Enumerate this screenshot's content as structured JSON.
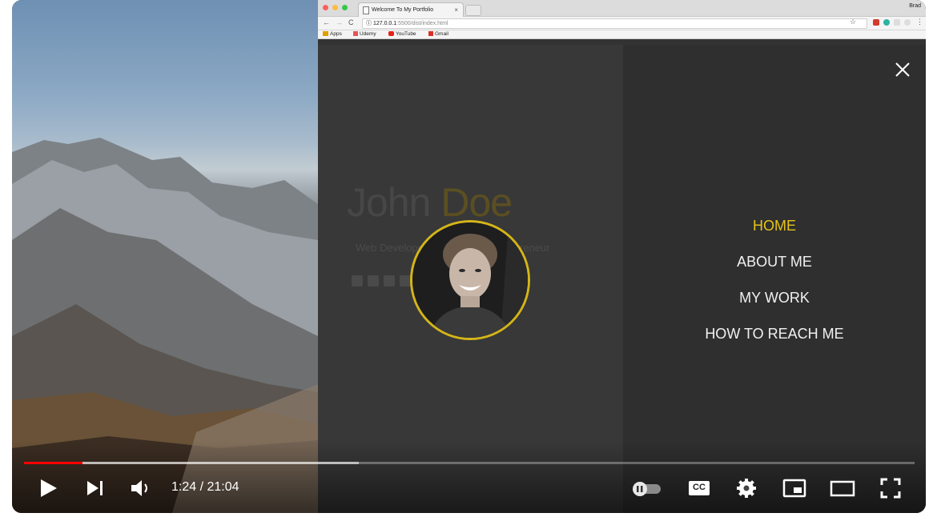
{
  "browser": {
    "tab_title": "Welcome To My Portfolio",
    "tab_close": "×",
    "user": "Brad",
    "url_host": "127.0.0.1",
    "url_path": ":5500/dist/index.html",
    "bookmarks": [
      {
        "label": "Apps",
        "icon": "apps-grid-icon",
        "color": "#e0a000"
      },
      {
        "label": "Udemy",
        "icon": "udemy-icon",
        "color": "#ec5252"
      },
      {
        "label": "YouTube",
        "icon": "youtube-icon",
        "color": "#e62117"
      },
      {
        "label": "Gmail",
        "icon": "gmail-icon",
        "color": "#d93025"
      }
    ]
  },
  "site": {
    "first_name": "John",
    "last_name": "Doe",
    "subtitle": "Web Developer, Designer, & Entrepreneur",
    "menu": [
      {
        "label": "HOME",
        "active": true
      },
      {
        "label": "ABOUT ME",
        "active": false
      },
      {
        "label": "MY WORK",
        "active": false
      },
      {
        "label": "HOW TO REACH ME",
        "active": false
      }
    ],
    "accent": "#e5c31b"
  },
  "player": {
    "current_time": "1:24",
    "separator": " / ",
    "duration": "21:04",
    "played_fraction": 0.066,
    "buffered_fraction": 0.376,
    "progress_color": "#ff0000",
    "cc_label": "CC"
  }
}
